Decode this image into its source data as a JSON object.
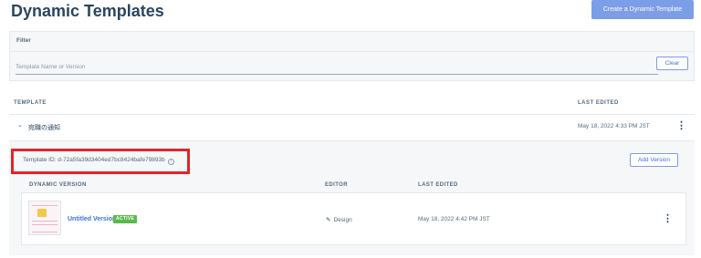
{
  "header": {
    "title": "Dynamic Templates",
    "create_label": "Create a Dynamic Template"
  },
  "filter": {
    "title": "Filter",
    "placeholder": "Template Name or Version",
    "value": "",
    "clear_label": "Clear"
  },
  "table": {
    "col_template": "TEMPLATE",
    "col_last_edited": "LAST EDITED",
    "rows": [
      {
        "name": "宛職の通知",
        "last_edited": "May 18, 2022 4:33 PM JST",
        "expanded": true,
        "template_id": "Template ID: d-72a5fa39d3404ed7bc8424bafe79893b",
        "add_version_label": "Add Version",
        "version_columns": {
          "version": "DYNAMIC VERSION",
          "editor": "EDITOR",
          "last_edited": "LAST EDITED"
        },
        "versions": [
          {
            "name": "Untitled Version",
            "status": "ACTIVE",
            "editor": "Design",
            "last_edited": "May 18, 2022 4:42 PM JST"
          }
        ]
      }
    ]
  },
  "icons": {
    "chevron": "chevron-down-icon",
    "info": "info-icon",
    "more": "kebab-menu-icon",
    "pencil": "pencil-icon"
  },
  "colors": {
    "primary": "#7c9de8",
    "link": "#3e72d6",
    "active_badge": "#5ab94b",
    "highlight_box": "#e3232c"
  }
}
